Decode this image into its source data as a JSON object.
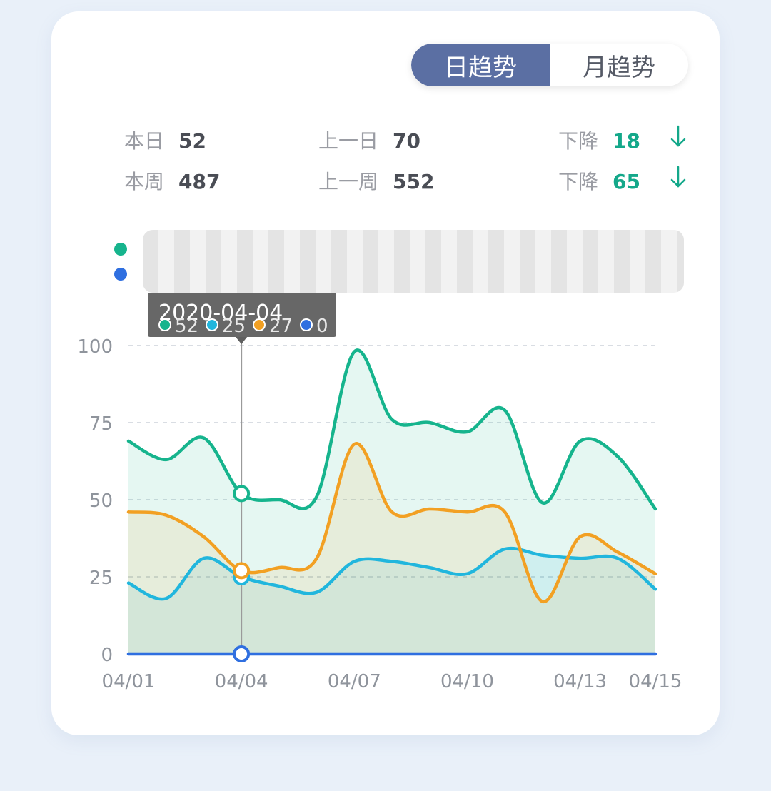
{
  "toggle": {
    "daily": "日趋势",
    "monthly": "月趋势",
    "active": "daily"
  },
  "stats": [
    {
      "label": "本日",
      "value": "52",
      "prev_label": "上一日",
      "prev_value": "70",
      "change_label": "下降",
      "change_value": "18",
      "direction": "down"
    },
    {
      "label": "本周",
      "value": "487",
      "prev_label": "上一周",
      "prev_value": "552",
      "change_label": "下降",
      "change_value": "65",
      "direction": "down"
    }
  ],
  "colors": {
    "green": "#16b48d",
    "cyan": "#21b6dd",
    "orange": "#f2a023",
    "blue": "#2f6fe0",
    "accent_down": "#14a88a",
    "toggle_active": "#5b6fa3"
  },
  "tooltip": {
    "date": "2020-04-04",
    "values": [
      "52",
      "25",
      "27",
      "0"
    ]
  },
  "chart_data": {
    "type": "area",
    "x": [
      "04/01",
      "04/02",
      "04/03",
      "04/04",
      "04/05",
      "04/06",
      "04/07",
      "04/08",
      "04/09",
      "04/10",
      "04/11",
      "04/12",
      "04/13",
      "04/14",
      "04/15"
    ],
    "x_tick_labels": [
      "04/01",
      "04/04",
      "04/07",
      "04/10",
      "04/13",
      "04/15"
    ],
    "ylim": [
      0,
      100
    ],
    "y_ticks": [
      0,
      25,
      50,
      75,
      100
    ],
    "grid": true,
    "highlight_index": 3,
    "series": [
      {
        "color": "#16b48d",
        "values": [
          69,
          63,
          70,
          52,
          50,
          51,
          98,
          76,
          75,
          72,
          79,
          49,
          69,
          64,
          47
        ]
      },
      {
        "color": "#21b6dd",
        "values": [
          23,
          18,
          31,
          25,
          22,
          20,
          30,
          30,
          28,
          26,
          34,
          32,
          31,
          31,
          21
        ]
      },
      {
        "color": "#f2a023",
        "values": [
          46,
          45,
          38,
          27,
          28,
          31,
          68,
          46,
          47,
          46,
          46,
          17,
          38,
          33,
          26
        ]
      },
      {
        "color": "#2f6fe0",
        "values": [
          0,
          0,
          0,
          0,
          0,
          0,
          0,
          0,
          0,
          0,
          0,
          0,
          0,
          0,
          0
        ]
      }
    ]
  }
}
